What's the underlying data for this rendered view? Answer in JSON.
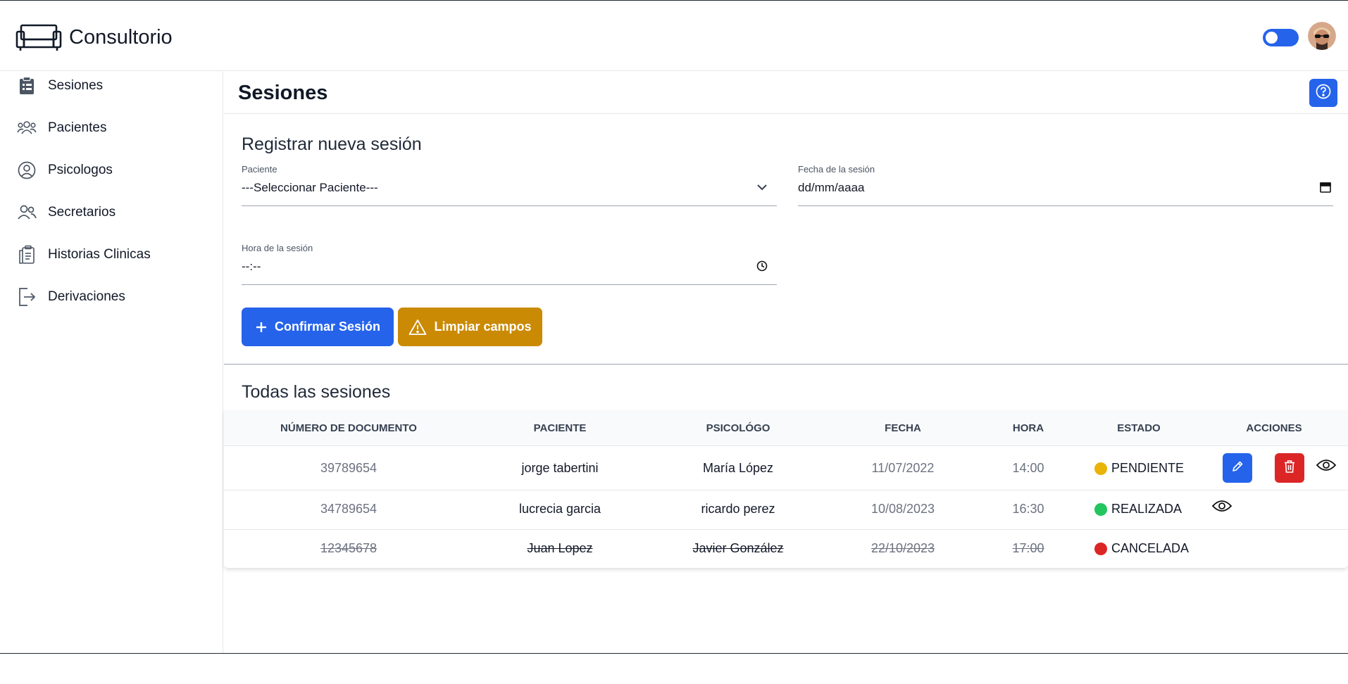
{
  "app": {
    "brand_name": "Consultorio",
    "logo_icon": "sofa-icon",
    "avatar_icon": "user-avatar"
  },
  "colors": {
    "primary": "#2563eb",
    "warning": "#ca8a04",
    "danger": "#dc2626",
    "pending": "#eab308",
    "done": "#22c55e",
    "cancelled": "#dc2626"
  },
  "sidebar": {
    "items": [
      {
        "label": "Sesiones",
        "icon": "clipboard-list-icon"
      },
      {
        "label": "Pacientes",
        "icon": "users-group-icon"
      },
      {
        "label": "Psicologos",
        "icon": "user-circle-icon"
      },
      {
        "label": "Secretarios",
        "icon": "users-icon"
      },
      {
        "label": "Historias Clinicas",
        "icon": "clipboard-copy-icon"
      },
      {
        "label": "Derivaciones",
        "icon": "logout-icon"
      }
    ]
  },
  "main": {
    "page_title": "Sesiones",
    "help_icon": "question-circle-icon"
  },
  "form": {
    "title": "Registrar nueva sesión",
    "patient": {
      "label": "Paciente",
      "value": "---Seleccionar Paciente---"
    },
    "date": {
      "label": "Fecha de la sesión",
      "value": "dd/mm/aaaa"
    },
    "time": {
      "label": "Hora de la sesión",
      "value": "--:--"
    },
    "confirm_label": "Confirmar Sesión",
    "clear_label": "Limpiar campos"
  },
  "table": {
    "title": "Todas las sesiones",
    "columns": [
      "Número de documento",
      "Paciente",
      "Psicológo",
      "Fecha",
      "Hora",
      "Estado",
      "Acciones"
    ],
    "rows": [
      {
        "documento": "39789654",
        "paciente": "jorge tabertini",
        "psicologo": "María López",
        "fecha": "11/07/2022",
        "hora": "14:00",
        "estado": "PENDIENTE"
      },
      {
        "documento": "34789654",
        "paciente": "lucrecia garcia",
        "psicologo": "ricardo perez",
        "fecha": "10/08/2023",
        "hora": "16:30",
        "estado": "REALIZADA"
      },
      {
        "documento": "12345678",
        "paciente": "Juan Lopez",
        "psicologo": "Javier González",
        "fecha": "22/10/2023",
        "hora": "17:00",
        "estado": "CANCELADA"
      }
    ]
  }
}
